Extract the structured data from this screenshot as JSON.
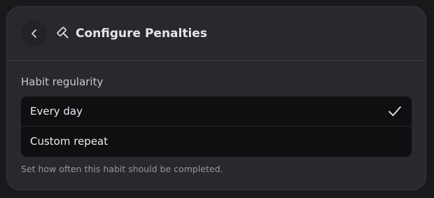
{
  "header": {
    "title": "Configure Penalties",
    "back_icon": "chevron-left-icon",
    "title_icon": "gavel-icon"
  },
  "regularity": {
    "label": "Habit regularity",
    "options": [
      {
        "label": "Every day",
        "selected": true
      },
      {
        "label": "Custom repeat",
        "selected": false
      }
    ],
    "helper": "Set how often this habit should be completed."
  },
  "colors": {
    "panel": "#29292d",
    "options_background": "#0f0f11",
    "text": "#e6e6ea",
    "muted": "#95959c"
  }
}
